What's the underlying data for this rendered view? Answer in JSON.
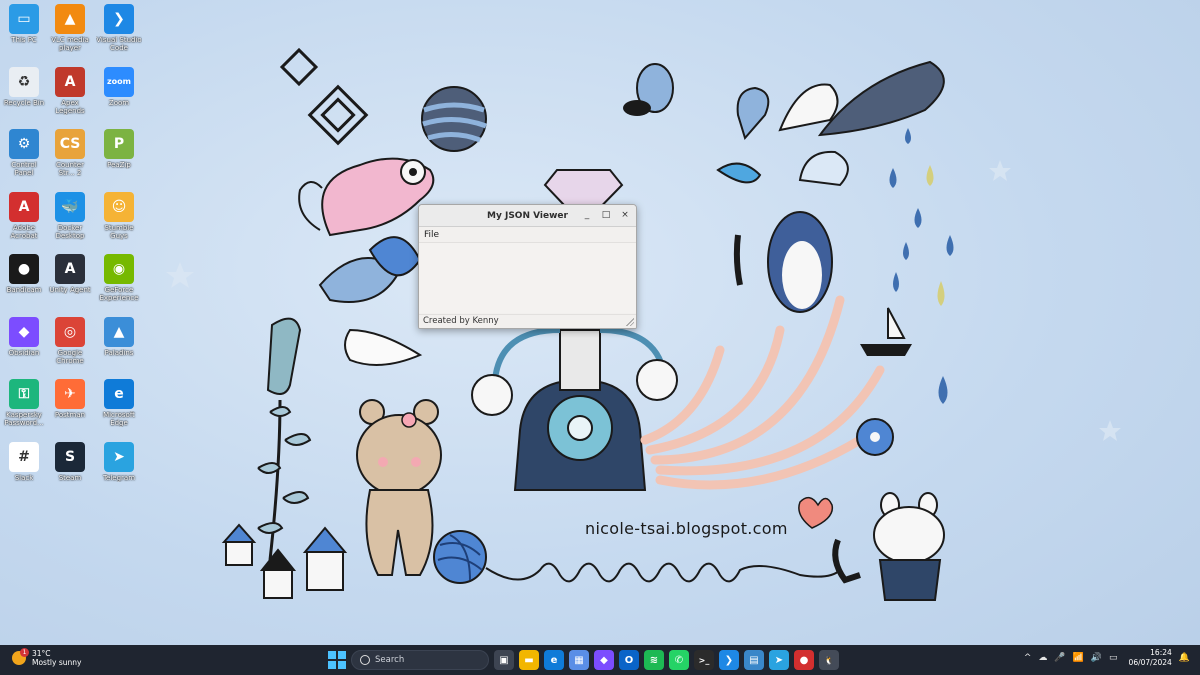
{
  "desktop": {
    "icons": [
      {
        "label": "This PC",
        "icon": "monitor-icon",
        "color": "#2b9be6",
        "glyph": "▭"
      },
      {
        "label": "VLC media player",
        "icon": "vlc-cone-icon",
        "color": "#f28a10",
        "glyph": "▲"
      },
      {
        "label": "Visual Studio Code",
        "icon": "vscode-icon",
        "color": "#1e88e5",
        "glyph": "❯"
      },
      {
        "label": "Recycle Bin",
        "icon": "recycle-bin-icon",
        "color": "#e9eef3",
        "glyph": "♻"
      },
      {
        "label": "Apex Legends",
        "icon": "apex-legends-icon",
        "color": "#c0392b",
        "glyph": "A"
      },
      {
        "label": "Zoom",
        "icon": "zoom-icon",
        "color": "#2d8cff",
        "glyph": "zoom"
      },
      {
        "label": "Control Panel",
        "icon": "control-panel-icon",
        "color": "#2f86d1",
        "glyph": "⚙"
      },
      {
        "label": "Counter Str... 2",
        "icon": "counter-strike-icon",
        "color": "#e8a33b",
        "glyph": "CS"
      },
      {
        "label": "PeaZip",
        "icon": "peazip-icon",
        "color": "#7cb342",
        "glyph": "P"
      },
      {
        "label": "Adobe Acrobat",
        "icon": "adobe-acrobat-icon",
        "color": "#d32f2f",
        "glyph": "A"
      },
      {
        "label": "Docker Desktop",
        "icon": "docker-icon",
        "color": "#1d91e6",
        "glyph": "🐳"
      },
      {
        "label": "Stumble Guys",
        "icon": "stumble-guys-icon",
        "color": "#f5b335",
        "glyph": "☺"
      },
      {
        "label": "Bandicam",
        "icon": "bandicam-icon",
        "color": "#1a1a1a",
        "glyph": "●"
      },
      {
        "label": "Unity Agent",
        "icon": "unity-agent-icon",
        "color": "#2a2f3a",
        "glyph": "A"
      },
      {
        "label": "GeForce Experience",
        "icon": "geforce-icon",
        "color": "#76b900",
        "glyph": "◉"
      },
      {
        "label": "Obsidian",
        "icon": "obsidian-icon",
        "color": "#7c4dff",
        "glyph": "◆"
      },
      {
        "label": "Google Chrome",
        "icon": "chrome-icon",
        "color": "#db4437",
        "glyph": "◎"
      },
      {
        "label": "Paladins",
        "icon": "paladins-icon",
        "color": "#3b8ed8",
        "glyph": "▲"
      },
      {
        "label": "Kaspersky Password...",
        "icon": "kaspersky-icon",
        "color": "#1db67d",
        "glyph": "⚿"
      },
      {
        "label": "Postman",
        "icon": "postman-icon",
        "color": "#ff6c37",
        "glyph": "✈"
      },
      {
        "label": "Microsoft Edge",
        "icon": "edge-icon",
        "color": "#0f7bd8",
        "glyph": "e"
      },
      {
        "label": "Slack",
        "icon": "slack-icon",
        "color": "#ffffff",
        "glyph": "#"
      },
      {
        "label": "Steam",
        "icon": "steam-icon",
        "color": "#1b2838",
        "glyph": "S"
      },
      {
        "label": "Telegram",
        "icon": "telegram-icon",
        "color": "#2aa3e0",
        "glyph": "➤"
      }
    ],
    "watermark": "nicole-tsai.blogspot.com"
  },
  "window": {
    "title": "My JSON Viewer",
    "minimize": "_",
    "maximize": "□",
    "close": "×",
    "menu": [
      "File"
    ],
    "status": "Created by Kenny"
  },
  "taskbar": {
    "weather_temp": "31°C",
    "weather_desc": "Mostly sunny",
    "weather_badge": "1",
    "search_placeholder": "Search",
    "apps": [
      {
        "name": "task-view",
        "color": "#3d4452",
        "glyph": "▣"
      },
      {
        "name": "file-explorer",
        "color": "#f2b600",
        "glyph": "▬"
      },
      {
        "name": "edge",
        "color": "#0f7bd8",
        "glyph": "e"
      },
      {
        "name": "microsoft-store",
        "color": "#5a8ee6",
        "glyph": "▦"
      },
      {
        "name": "obsidian",
        "color": "#7c4dff",
        "glyph": "◆"
      },
      {
        "name": "outlook",
        "color": "#0a64c8",
        "glyph": "O"
      },
      {
        "name": "spotify",
        "color": "#1db954",
        "glyph": "≋"
      },
      {
        "name": "whatsapp",
        "color": "#25d366",
        "glyph": "✆"
      },
      {
        "name": "terminal",
        "color": "#2b2b2b",
        "glyph": ">_"
      },
      {
        "name": "vscode",
        "color": "#1e88e5",
        "glyph": "❯"
      },
      {
        "name": "task-manager",
        "color": "#3a87c9",
        "glyph": "▤"
      },
      {
        "name": "telegram",
        "color": "#2aa3e0",
        "glyph": "➤"
      },
      {
        "name": "bandicam",
        "color": "#d32f2f",
        "glyph": "●"
      },
      {
        "name": "linux-app",
        "color": "#444b58",
        "glyph": "🐧"
      }
    ],
    "tray": {
      "chevron": "^",
      "clock_time": "16:24",
      "clock_date": "06/07/2024"
    }
  }
}
